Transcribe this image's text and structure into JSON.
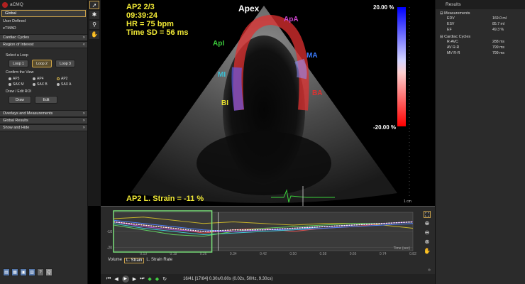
{
  "app": {
    "title": "aCMQ"
  },
  "nav": {
    "items": [
      {
        "label": "Global",
        "active": true
      },
      {
        "label": "User Defined",
        "active": false
      },
      {
        "label": "eTMAD",
        "active": false
      }
    ]
  },
  "sections": {
    "cardiac_cycles": "Cardiac Cycles",
    "roi": "Region of Interest",
    "overlays": "Overlays and Measurements",
    "global_results": "Global Results",
    "show_hide": "Show and Hide"
  },
  "roi": {
    "select_loop_label": "Select a Loop",
    "loops": [
      "Loop 1",
      "Loop 2",
      "Loop 3"
    ],
    "selected_loop": "Loop 2",
    "confirm_view_label": "Confirm the View",
    "views": [
      "AP3",
      "AP4",
      "AP2",
      "SAX M",
      "SAX B",
      "SAX A"
    ],
    "selected_view": "AP2",
    "draw_edit_label": "Draw / Edit ROI",
    "draw_button": "Draw",
    "edit_button": "Edit"
  },
  "image": {
    "view_frame": "AP2  2/3",
    "time": "09:39:24",
    "hr": "HR = 75 bpm",
    "time_sd": "Time SD = 56 ms",
    "strain_label": "AP2 L. Strain = -11 %",
    "scale_label": "1 cm",
    "segments": {
      "apex": "Apex",
      "apa": "ApA",
      "api": "ApI",
      "ma": "MA",
      "mi": "MI",
      "ba": "BA",
      "bi": "BI"
    },
    "colorbar": {
      "top": "20.00 %",
      "bottom": "-20.00 %"
    }
  },
  "chart_data": {
    "type": "line",
    "x_ticks": [
      "0.10",
      "0.18",
      "0.26",
      "0.34",
      "0.42",
      "0.50",
      "0.58",
      "0.66",
      "0.74",
      "0.82"
    ],
    "y_ticks": [
      "-10",
      "-20"
    ],
    "xlabel": "Time (sec)",
    "xlim": [
      0.02,
      0.82
    ],
    "ylim": [
      -22,
      2
    ],
    "series": [
      {
        "color": "#c8b42a",
        "x": [
          0.02,
          0.1,
          0.18,
          0.26,
          0.34,
          0.42,
          0.5,
          0.58,
          0.66,
          0.74,
          0.82
        ],
        "y": [
          -2,
          -1,
          -3,
          -5,
          -4,
          -5,
          -6,
          -5,
          -5,
          -6,
          -8
        ]
      },
      {
        "color": "#e05050",
        "x": [
          0.02,
          0.1,
          0.18,
          0.26,
          0.34,
          0.42,
          0.5,
          0.58,
          0.66,
          0.74,
          0.82
        ],
        "y": [
          -4,
          -6,
          -8,
          -11,
          -9,
          -8,
          -10,
          -8,
          -7,
          -5,
          -4
        ]
      },
      {
        "color": "#5080ff",
        "x": [
          0.02,
          0.1,
          0.18,
          0.26,
          0.34,
          0.42,
          0.5,
          0.58,
          0.66,
          0.74,
          0.82
        ],
        "y": [
          -3,
          -5,
          -7,
          -9,
          -10,
          -9,
          -9,
          -8,
          -7,
          -6,
          -5
        ]
      },
      {
        "color": "#40c8d8",
        "x": [
          0.02,
          0.1,
          0.18,
          0.26,
          0.34,
          0.42,
          0.5,
          0.58,
          0.66,
          0.74,
          0.82
        ],
        "y": [
          -5,
          -8,
          -10,
          -12,
          -11,
          -10,
          -9,
          -7,
          -6,
          -5,
          -4
        ]
      },
      {
        "color": "#60d060",
        "x": [
          0.02,
          0.1,
          0.18,
          0.26,
          0.34,
          0.42,
          0.5,
          0.58,
          0.66,
          0.74,
          0.82
        ],
        "y": [
          -6,
          -9,
          -12,
          -13,
          -10,
          -8,
          -7,
          -6,
          -5,
          -5,
          -4
        ]
      },
      {
        "color": "#b050e0",
        "x": [
          0.02,
          0.1,
          0.18,
          0.26,
          0.34,
          0.42,
          0.5,
          0.58,
          0.66,
          0.74,
          0.82
        ],
        "y": [
          -4,
          -7,
          -9,
          -10,
          -10,
          -9,
          -8,
          -7,
          -6,
          -5,
          -4
        ]
      },
      {
        "color": "#ffffff",
        "dashed": true,
        "x": [
          0.02,
          0.1,
          0.18,
          0.26,
          0.34,
          0.42,
          0.5,
          0.58,
          0.66,
          0.74,
          0.82
        ],
        "y": [
          -4,
          -6,
          -8,
          -10,
          -9,
          -9,
          -8,
          -7,
          -6,
          -5,
          -4
        ]
      }
    ]
  },
  "chart_tabs": {
    "label": "Volume",
    "items": [
      "L. Strain",
      "L. Strain Rate"
    ],
    "selected": "L. Strain"
  },
  "playbar": {
    "status": "16/41 [17/84] 0.30s/0.80s (0.02s, 50Hz, 9.30cs)"
  },
  "results": {
    "title": "Results",
    "measurements": {
      "heading": "Measurements",
      "rows": [
        {
          "label": "EDV",
          "value": "169.0 ml"
        },
        {
          "label": "ESV",
          "value": "85.7 ml"
        },
        {
          "label": "EF",
          "value": "49.3 %"
        }
      ]
    },
    "cardiac_cycles": {
      "heading": "Cardiac Cycles",
      "rows": [
        {
          "label": "R-AVC",
          "value": "288 ms"
        },
        {
          "label": "AV R-R",
          "value": "799 ms"
        },
        {
          "label": "MV R-R",
          "value": "799 ms"
        }
      ]
    }
  }
}
